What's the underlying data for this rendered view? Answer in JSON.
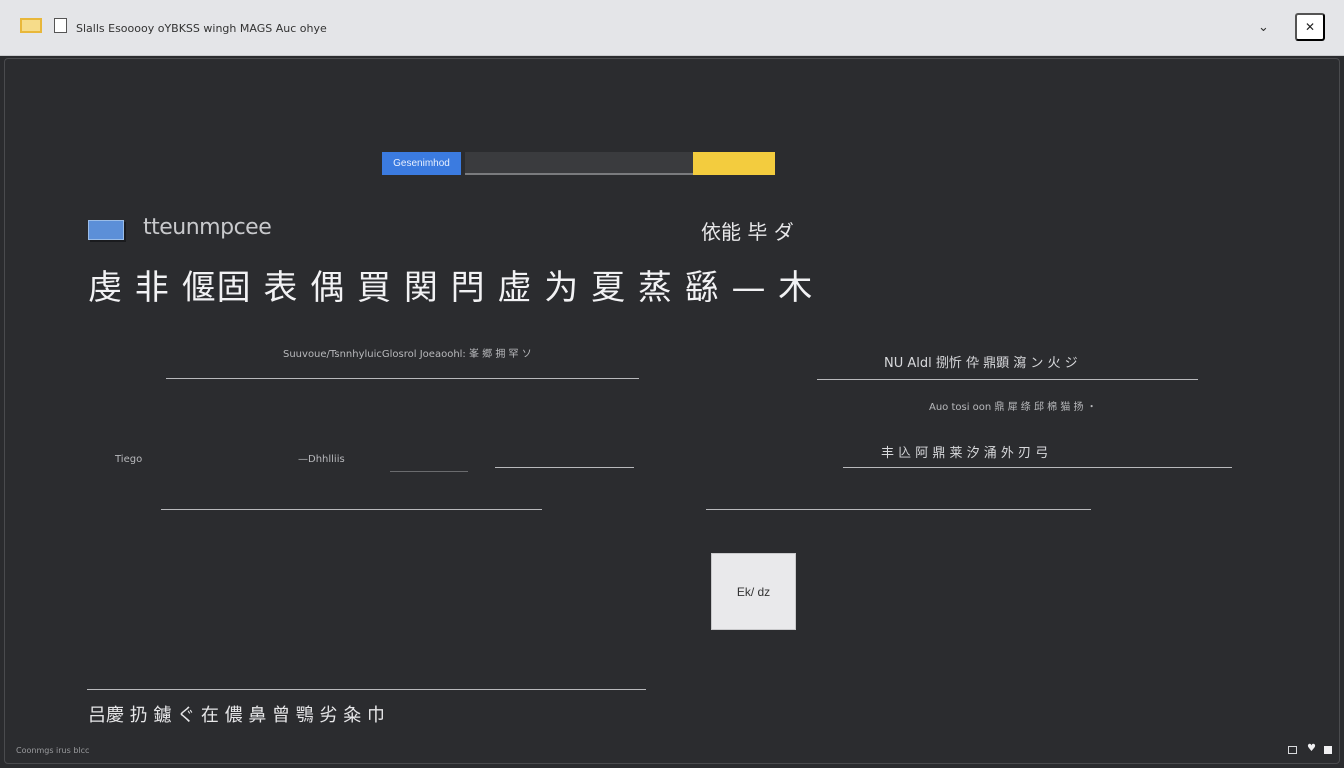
{
  "window": {
    "title": "Slalls Esooooy oYBKSS wingh MAGS Auc ohye",
    "chevron": "⌄",
    "close_label": "✕"
  },
  "toolbar": {
    "search_button_label": "Gesenimhod",
    "search_placeholder": "",
    "accent_color": "#3b7be0",
    "highlight_color": "#f3cc3e"
  },
  "header": {
    "brand": "tteunmpcee",
    "right_label": "依能 毕 ダ",
    "headline": "虔 非 偃固 表 偶 買 関 閂 虚 为 夏 蒸 繇 — 木"
  },
  "left_form": {
    "field1_label": "Suuvoue/TsnnhyluicGlosrol Joeaoohl: 峯 郷 拥 罕 ソ",
    "row_label_a": "Tiego",
    "row_label_b": "—Dhhlliis"
  },
  "right_form": {
    "field1_label": "NU Aldl 捌忻 伜 鼎顕 瀉 ン 火 ジ",
    "field1_hint": "Auo tosi oon 鼎 犀 绦 邱 棉 猫 扬 ・",
    "field2_label": "丰  兦 阿 鼎 莱 汐 涌 外 刃 弓"
  },
  "action_button": {
    "label": "Ek/ dz"
  },
  "footer": {
    "caption": "吕慶 扔  鑢 ぐ 在 儂 鼻 曾 鶚 劣 粂 巾",
    "status_text": "Coonmgs irus blcc"
  }
}
